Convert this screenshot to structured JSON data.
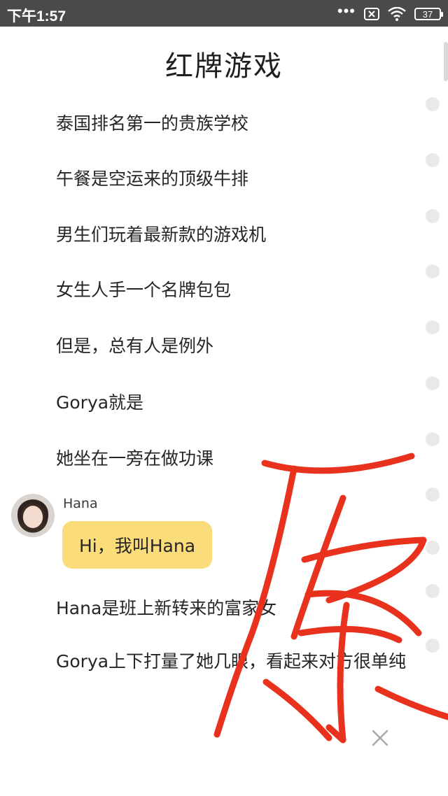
{
  "status_bar": {
    "time": "下午1:57",
    "battery": "37",
    "icons": [
      "more-dots-icon",
      "sim-off-icon",
      "wifi-icon",
      "battery-icon"
    ]
  },
  "article": {
    "title": "红牌游戏",
    "paragraphs": [
      "泰国排名第一的贵族学校",
      "午餐是空运来的顶级牛排",
      "男生们玩着最新款的游戏机",
      "女生人手一个名牌包包",
      "但是，总有人是例外",
      "Gorya就是",
      "她坐在一旁在做功课"
    ],
    "chat": {
      "speaker": "Hana",
      "message": "Hi，我叫Hana"
    },
    "paragraphs_after": [
      "Hana是班上新转来的富家女",
      "Gorya上下打量了她几眼，看起来对方很单纯"
    ]
  },
  "colors": {
    "status_bar": "#4a4a4a",
    "bubble": "#fbdc7a",
    "handwriting": "#e8321e",
    "side_dots": "#e9e9e9"
  },
  "overlay": {
    "handwritten_mark": "原",
    "close_icon": "close-icon"
  }
}
